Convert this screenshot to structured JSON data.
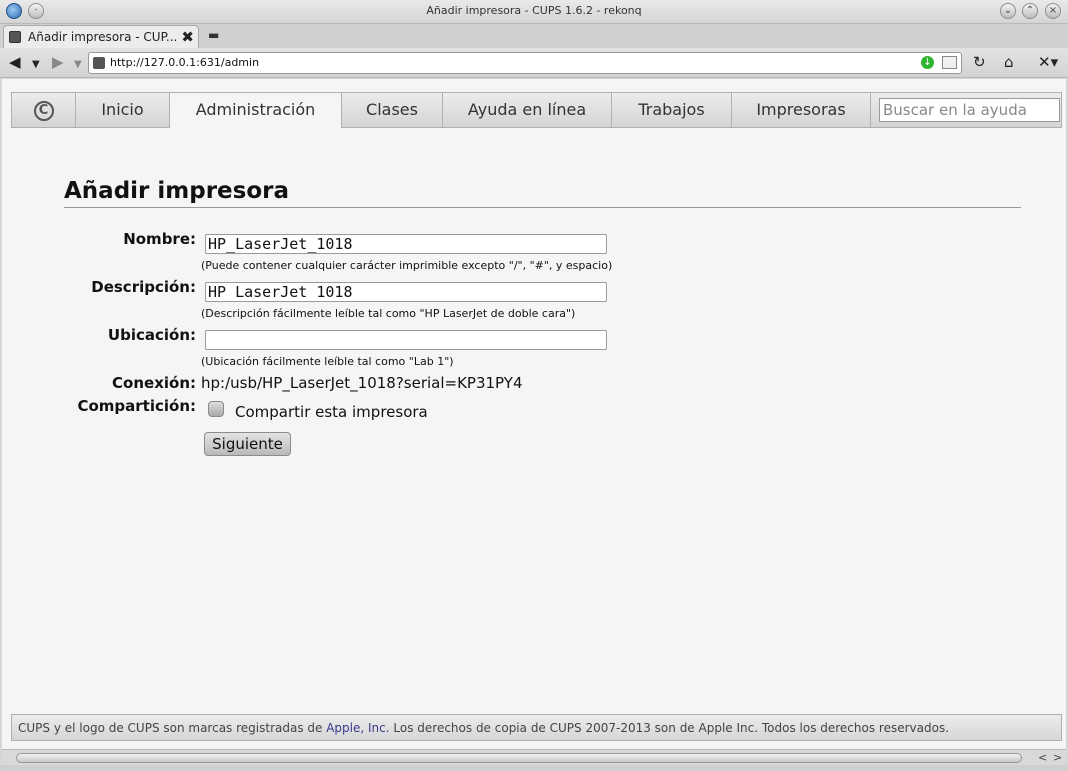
{
  "window": {
    "title": "Añadir impresora - CUPS 1.6.2 - rekonq"
  },
  "tab": {
    "label": "Añadir impresora - CUP..."
  },
  "toolbar": {
    "url": "http://127.0.0.1:631/admin"
  },
  "nav": {
    "items": [
      "Inicio",
      "Administración",
      "Clases",
      "Ayuda en línea",
      "Trabajos",
      "Impresoras"
    ],
    "active": "Administración",
    "search_placeholder": "Buscar en la ayuda"
  },
  "page": {
    "heading": "Añadir impresora",
    "fields": {
      "nombre_label": "Nombre:",
      "nombre_value": "HP_LaserJet_1018",
      "nombre_hint": "(Puede contener cualquier carácter imprimible excepto \"/\", \"#\", y espacio)",
      "descripcion_label": "Descripción:",
      "descripcion_value": "HP LaserJet 1018",
      "descripcion_hint": "(Descripción fácilmente leíble tal como \"HP LaserJet de doble cara\")",
      "ubicacion_label": "Ubicación:",
      "ubicacion_value": "",
      "ubicacion_hint": "(Ubicación fácilmente leíble tal como \"Lab 1\")",
      "conexion_label": "Conexión:",
      "conexion_value": "hp:/usb/HP_LaserJet_1018?serial=KP31PY4",
      "comparticion_label": "Compartición:",
      "share_label": "Compartir esta impresora",
      "share_checked": false
    },
    "submit_label": "Siguiente"
  },
  "footer": {
    "text_before": "CUPS y el logo de CUPS son marcas registradas de ",
    "link": "Apple, Inc.",
    "text_after": " Los derechos de copia de CUPS 2007-2013 son de Apple Inc. Todos los derechos reservados."
  }
}
